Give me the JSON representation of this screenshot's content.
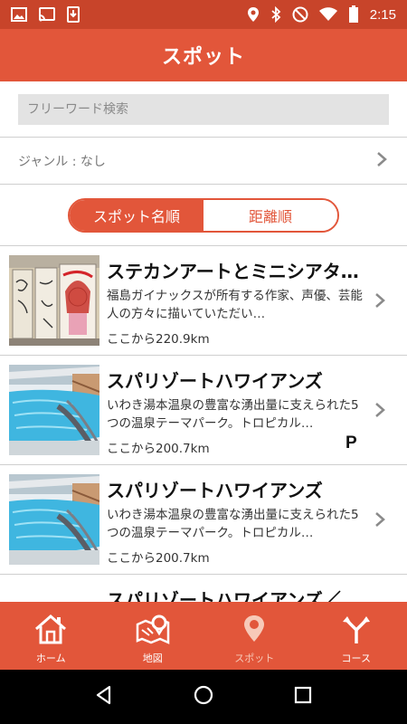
{
  "status_bar": {
    "time": "2:15"
  },
  "header": {
    "title": "スポット"
  },
  "search": {
    "placeholder": "フリーワード検索",
    "value": ""
  },
  "genre": {
    "label": "ジャンル : なし"
  },
  "sort": {
    "options": [
      "スポット名順",
      "距離順"
    ],
    "selected": "スポット名順"
  },
  "spots": [
    {
      "title": "ステカンアートとミニシアタ…",
      "description": "福島ガイナックスが所有する作家、声優、芸能人の方々に描いていただい…",
      "distance": "ここから220.9km",
      "parking": "",
      "thumbnail": "art-panels-image"
    },
    {
      "title": "スパリゾートハワイアンズ",
      "description": "いわき湯本温泉の豊富な湧出量に支えられた5つの温泉テーマパーク。トロピカル…",
      "distance": "ここから200.7km",
      "parking": "P",
      "thumbnail": "pool-image"
    },
    {
      "title": "スパリゾートハワイアンズ",
      "description": "いわき湯本温泉の豊富な湧出量に支えられた5つの温泉テーマパーク。トロピカル…",
      "distance": "ここから200.7km",
      "parking": "",
      "thumbnail": "pool-image"
    },
    {
      "title": "スパリゾートハワイアンズ／…",
      "description": "",
      "distance": "",
      "parking": "",
      "thumbnail": ""
    }
  ],
  "tabs": [
    {
      "label": "ホーム",
      "icon": "home-icon"
    },
    {
      "label": "地図",
      "icon": "map-icon"
    },
    {
      "label": "スポット",
      "icon": "pin-icon"
    },
    {
      "label": "コース",
      "icon": "route-icon"
    }
  ],
  "active_tab": "スポット",
  "colors": {
    "primary": "#e2563a",
    "status_bar": "#c8442a",
    "active_tab_tint": "#f7c9b8"
  }
}
